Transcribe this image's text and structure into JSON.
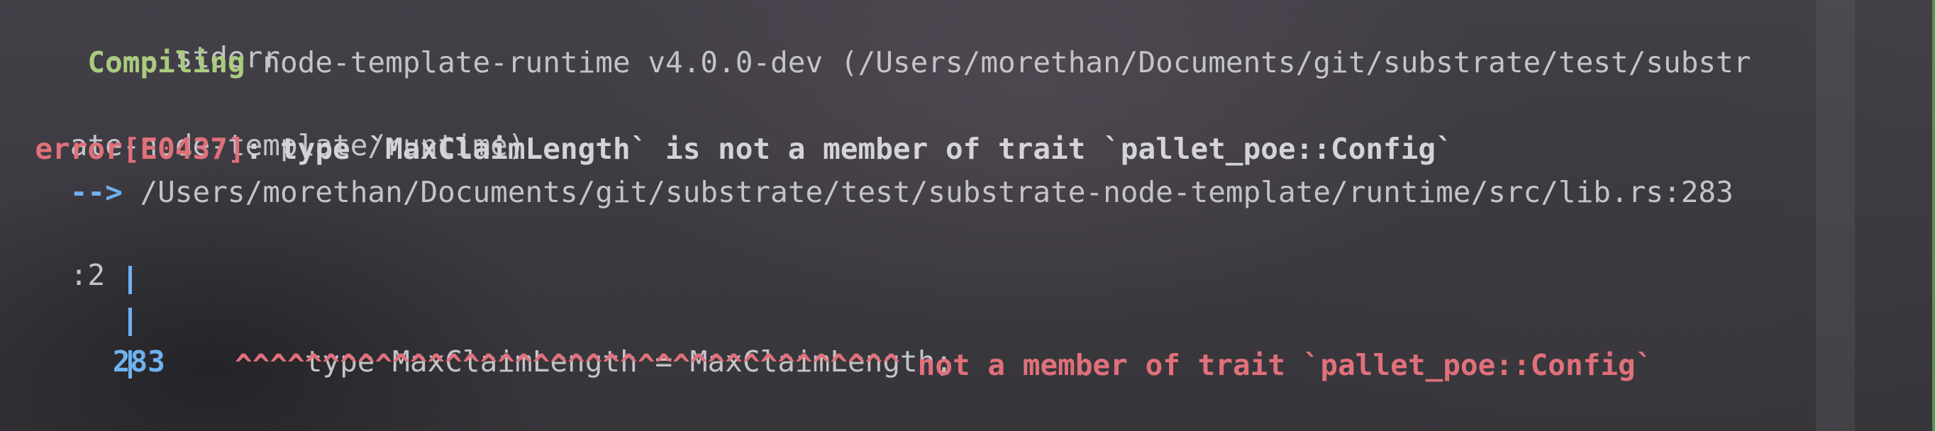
{
  "terminal": {
    "l1": "  --- stderr",
    "compile_indent": "     ",
    "compile_word": "Compiling",
    "compile_rest": " node-template-runtime v4.0.0-dev (/Users/morethan/Documents/git/substrate/test/substr",
    "compile_wrap": "ate-node-template/runtime)",
    "error_indent": "  ",
    "error_code": "error[E0437]",
    "error_message": ": type `MaxClaimLength` is not a member of trait `pallet_poe::Config`",
    "arrow_indent": "    ",
    "arrow": "-->",
    "location": " /Users/morethan/Documents/git/substrate/test/substrate-node-template/runtime/src/lib.rs:283",
    "location_wrap": ":2",
    "line_number": "283",
    "code_line": "type MaxClaimLength = MaxClaimLength;",
    "carets": "^^^^^^^^^^^^^^^^^^^^^^^^^^^^^^^^^^^^^^",
    "caret_message": " not a member of trait `pallet_poe::Config`"
  },
  "colors": {
    "green": "#a9cc7d",
    "red": "#e0707a",
    "blue": "#6fb1f0",
    "text": "#c3c3c8"
  }
}
